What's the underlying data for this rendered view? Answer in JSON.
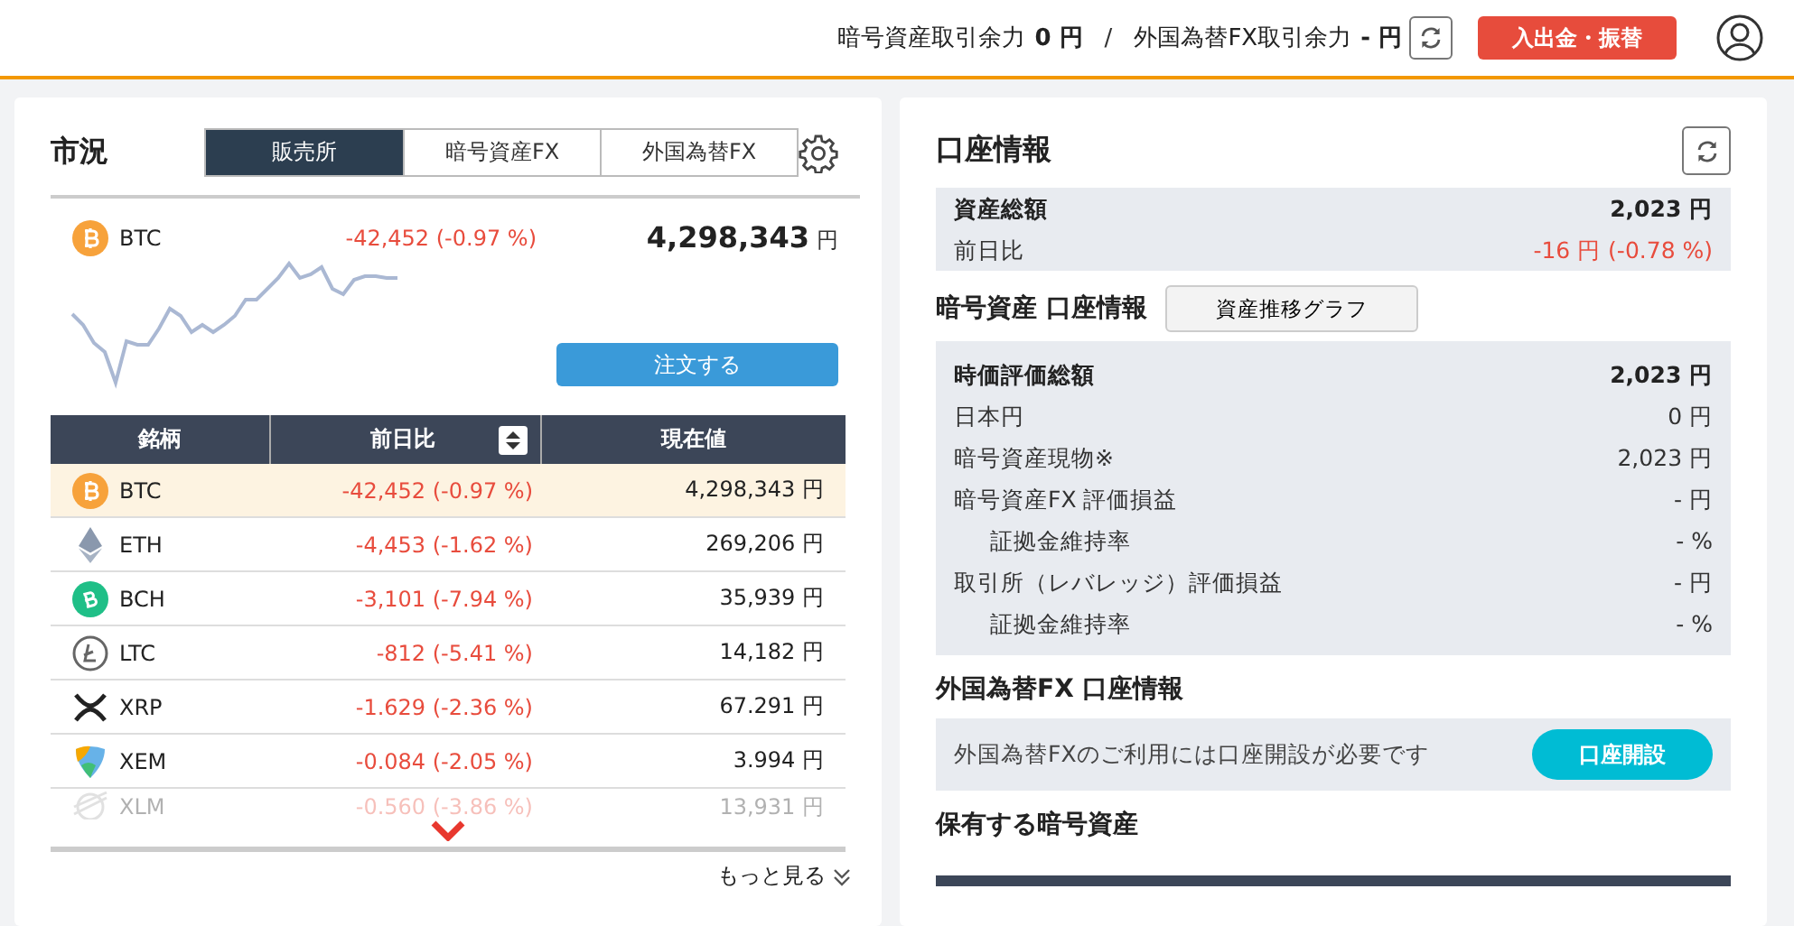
{
  "header": {
    "crypto_label": "暗号資産取引余力",
    "crypto_value": "0 円",
    "separator": "/",
    "fx_label": "外国為替FX取引余力",
    "fx_value": "- 円",
    "deposit_button": "入出金・振替"
  },
  "market": {
    "title": "市況",
    "tabs": [
      {
        "label": "販売所",
        "selected": true
      },
      {
        "label": "暗号資産FX",
        "selected": false
      },
      {
        "label": "外国為替FX",
        "selected": false
      }
    ],
    "featured": {
      "kind": "btc",
      "symbol": "BTC",
      "change": "-42,452 (-0.97 %)",
      "price": "4,298,343",
      "unit": "円"
    },
    "order_button": "注文する",
    "columns": [
      "銘柄",
      "前日比",
      "現在値"
    ],
    "rows": [
      {
        "kind": "btc",
        "symbol": "BTC",
        "change": "-42,452 (-0.97 %)",
        "price": "4,298,343 円",
        "selected": true,
        "faded": false
      },
      {
        "kind": "eth",
        "symbol": "ETH",
        "change": "-4,453 (-1.62 %)",
        "price": "269,206 円",
        "selected": false,
        "faded": false
      },
      {
        "kind": "bch",
        "symbol": "BCH",
        "change": "-3,101 (-7.94 %)",
        "price": "35,939 円",
        "selected": false,
        "faded": false
      },
      {
        "kind": "ltc",
        "symbol": "LTC",
        "change": "-812 (-5.41 %)",
        "price": "14,182 円",
        "selected": false,
        "faded": false
      },
      {
        "kind": "xrp",
        "symbol": "XRP",
        "change": "-1.629 (-2.36 %)",
        "price": "67.291 円",
        "selected": false,
        "faded": false
      },
      {
        "kind": "xem",
        "symbol": "XEM",
        "change": "-0.084 (-2.05 %)",
        "price": "3.994 円",
        "selected": false,
        "faded": false
      },
      {
        "kind": "xlm",
        "symbol": "XLM",
        "change": "-0.560 (-3.86 %)",
        "price": "13,931 円",
        "selected": false,
        "faded": true
      }
    ],
    "more_link": "もっと見る"
  },
  "account": {
    "title": "口座情報",
    "total": {
      "label": "資産総額",
      "value": "2,023 円"
    },
    "change": {
      "label": "前日比",
      "value": "-16 円 (-0.78 %)"
    },
    "crypto_title": "暗号資産 口座情報",
    "graph_button": "資産推移グラフ",
    "crypto_rows": [
      {
        "label": "時価評価総額",
        "value": "2,023 円",
        "bold": true,
        "indented": false
      },
      {
        "label": "日本円",
        "value": "0 円",
        "bold": false,
        "indented": false
      },
      {
        "label": "暗号資産現物※",
        "value": "2,023 円",
        "bold": false,
        "indented": false
      },
      {
        "label": "暗号資産FX 評価損益",
        "value": "- 円",
        "bold": false,
        "indented": false
      },
      {
        "label": "証拠金維持率",
        "value": "- %",
        "bold": false,
        "indented": true
      },
      {
        "label": "取引所（レバレッジ）評価損益",
        "value": "- 円",
        "bold": false,
        "indented": false
      },
      {
        "label": "証拠金維持率",
        "value": "- %",
        "bold": false,
        "indented": true
      }
    ],
    "fx_title": "外国為替FX 口座情報",
    "fx_notice": "外国為替FXのご利用には口座開設が必要です",
    "fx_open_button": "口座開設",
    "holdings_title": "保有する暗号資産"
  }
}
